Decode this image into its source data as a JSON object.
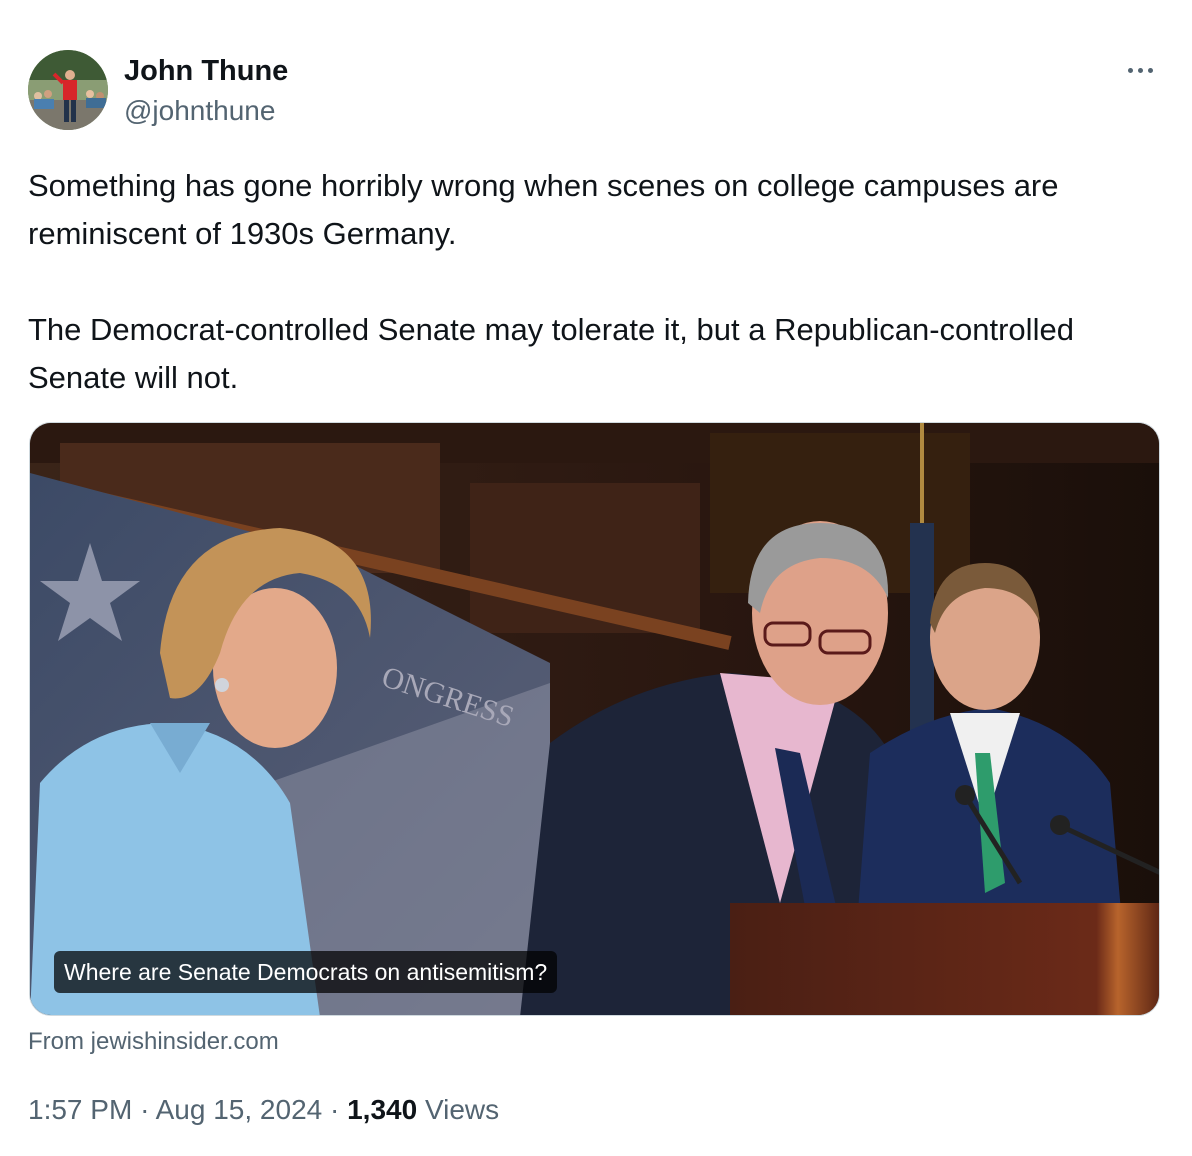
{
  "author": {
    "name": "John Thune",
    "handle": "@johnthune"
  },
  "tweet": {
    "text": "Something has gone horribly wrong when scenes on college campuses are reminiscent of 1930s Germany.\n\nThe Democrat-controlled Senate may tolerate it, but a Republican-controlled Senate will not."
  },
  "link_card": {
    "title": "Where are Senate Democrats on antisemitism?",
    "source": "From jewishinsider.com"
  },
  "meta": {
    "time": "1:57 PM",
    "separator": "·",
    "date": "Aug 15, 2024",
    "views_count": "1,340",
    "views_label": "Views"
  },
  "icons": {
    "more": "more-horizontal-icon"
  },
  "colors": {
    "text_primary": "#0f1419",
    "text_secondary": "#536471",
    "card_border": "#cfd9de"
  }
}
